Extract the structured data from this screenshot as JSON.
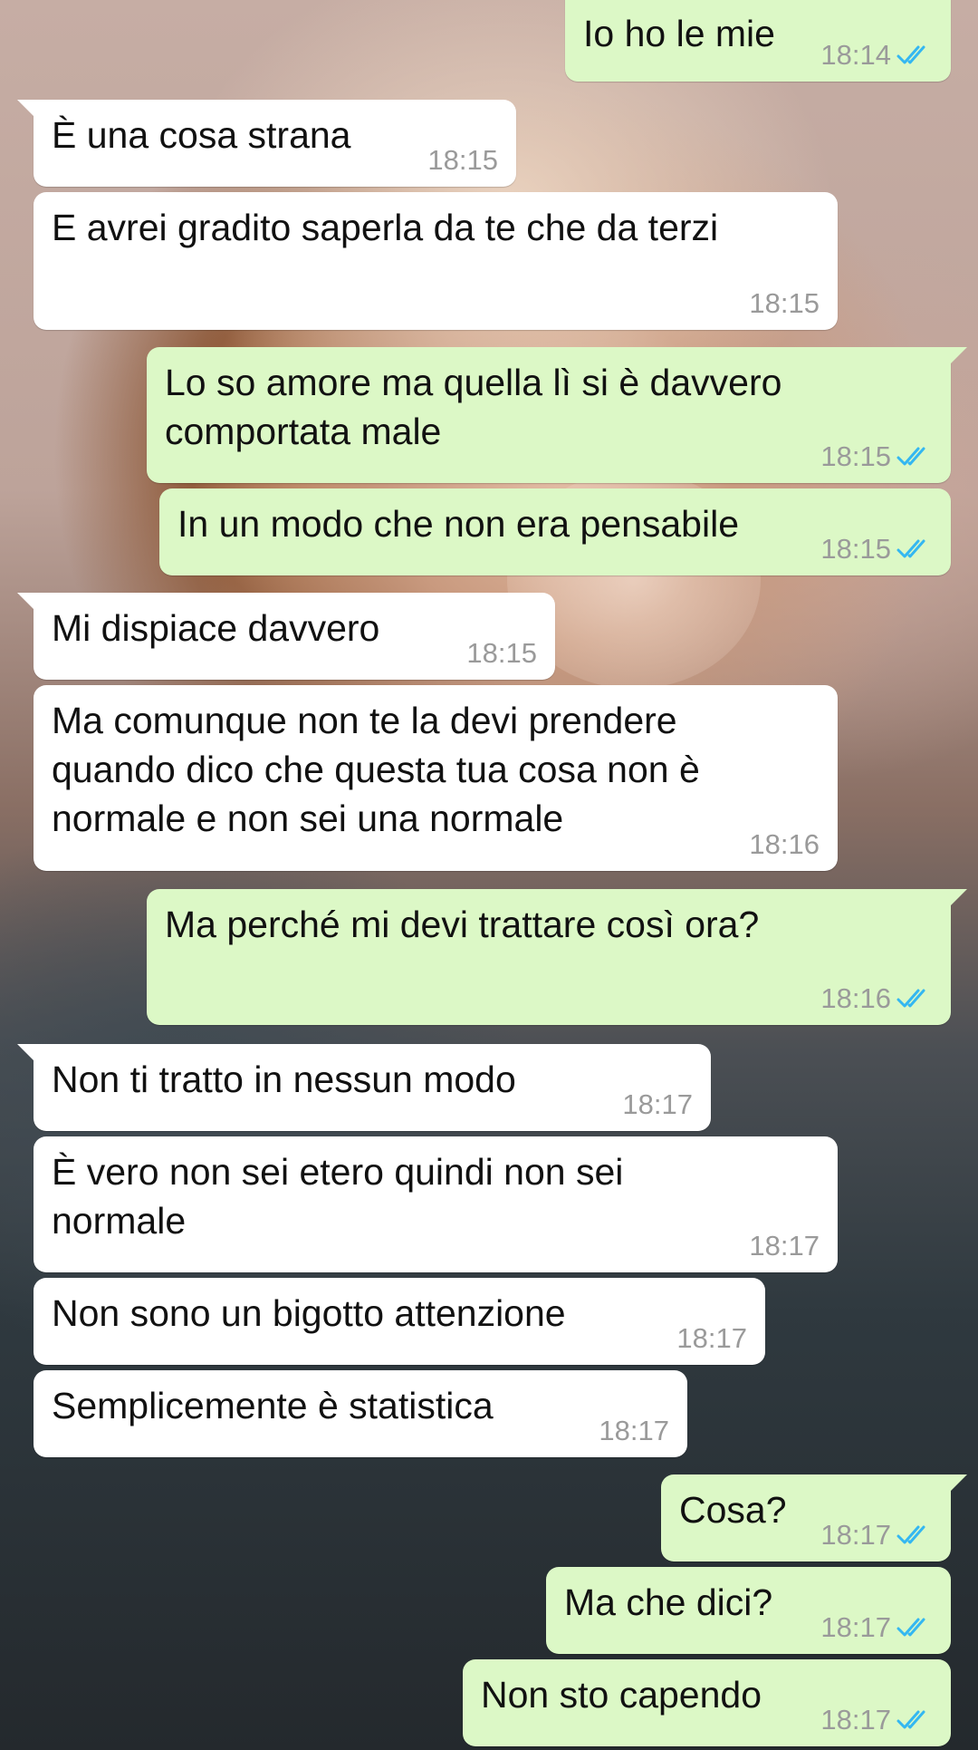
{
  "colors": {
    "incoming_bubble": "#ffffff",
    "outgoing_bubble": "#dcf8c6",
    "time_text": "#9a9a9a",
    "read_ticks": "#34b7f1"
  },
  "messages": [
    {
      "direction": "out",
      "text": "Io ho le mie",
      "time": "18:14",
      "status": "read-ticks-icon"
    },
    {
      "direction": "in",
      "text": "È una cosa strana",
      "time": "18:15"
    },
    {
      "direction": "in",
      "text": "E avrei gradito saperla da te che da terzi",
      "time": "18:15"
    },
    {
      "direction": "out",
      "text": "Lo so amore ma quella lì si è davvero\ncomportata male",
      "time": "18:15",
      "status": "read-ticks-icon"
    },
    {
      "direction": "out",
      "text": "In un modo che non era pensabile",
      "time": "18:15",
      "status": "read-ticks-icon"
    },
    {
      "direction": "in",
      "text": "Mi dispiace davvero",
      "time": "18:15"
    },
    {
      "direction": "in",
      "text": "Ma comunque non te la devi prendere\nquando dico che questa tua cosa non è\nnormale e non sei una normale",
      "time": "18:16"
    },
    {
      "direction": "out",
      "text": "Ma perché mi devi trattare così ora?",
      "time": "18:16",
      "status": "read-ticks-icon"
    },
    {
      "direction": "in",
      "text": "Non ti tratto in nessun modo",
      "time": "18:17"
    },
    {
      "direction": "in",
      "text": "È vero non sei etero quindi non sei\nnormale",
      "time": "18:17"
    },
    {
      "direction": "in",
      "text": "Non sono un bigotto attenzione",
      "time": "18:17"
    },
    {
      "direction": "in",
      "text": "Semplicemente è statistica",
      "time": "18:17"
    },
    {
      "direction": "out",
      "text": "Cosa?",
      "time": "18:17",
      "status": "read-ticks-icon"
    },
    {
      "direction": "out",
      "text": "Ma che dici?",
      "time": "18:17",
      "status": "read-ticks-icon"
    },
    {
      "direction": "out",
      "text": "Non sto capendo",
      "time": "18:17",
      "status": "read-ticks-icon"
    }
  ]
}
